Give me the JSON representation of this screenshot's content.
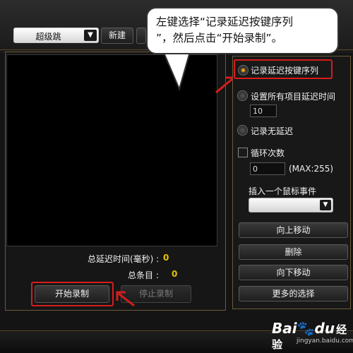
{
  "toolbar": {
    "macro_select_value": "超级跳",
    "new_button": "新建"
  },
  "callout": {
    "line1": "左键选择“记录延迟按键序列",
    "line2": "”，然后点击“开始录制”。"
  },
  "left_panel": {
    "total_delay_label": "总延迟时间(毫秒) :",
    "total_delay_value": "0",
    "total_items_label": "总条目 :",
    "total_items_value": "0",
    "start_record_button": "开始录制",
    "stop_record_button": "停止录制"
  },
  "right_panel": {
    "option_record_delay": "记录延迟按键序列",
    "option_set_all_delay": "设置所有项目延迟时间",
    "set_all_delay_value": "10",
    "option_no_delay": "记录无延迟",
    "loop_label": "循环次数",
    "loop_value": "0",
    "loop_max": "(MAX:255)",
    "insert_mouse_event_label": "插入一个鼠标事件",
    "move_up_button": "向上移动",
    "delete_button": "删除",
    "move_down_button": "向下移动",
    "more_options_button": "更多的选择"
  },
  "watermark": {
    "logo_bai": "Bai",
    "logo_du": "du",
    "logo_jingyan": "经验",
    "url": "jingyan.baidu.com"
  },
  "colors": {
    "highlight_red": "#d81c1c",
    "value_yellow": "#e8c200",
    "radio_selected": "#e8a000",
    "panel_border": "#6b5a3a"
  },
  "icons": {
    "dropdown_arrow": "chevron-down-icon",
    "logo_paw": "baidu-paw-icon"
  }
}
